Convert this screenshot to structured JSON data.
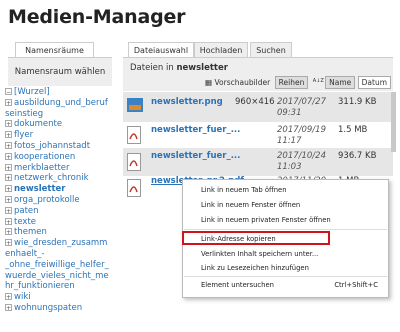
{
  "page": {
    "title": "Medien-Manager"
  },
  "left": {
    "tab_label": "Namensräume",
    "header": "Namensraum wählen",
    "tree": [
      {
        "label": "[Wurzel]",
        "pm": "⊟"
      },
      {
        "label": "ausbildung_und_beruf",
        "pm": "⊞"
      },
      {
        "label": "seinstieg",
        "pm": ""
      },
      {
        "label": "dokumente",
        "pm": "⊞"
      },
      {
        "label": "flyer",
        "pm": "⊞"
      },
      {
        "label": "fotos_johannstadt",
        "pm": "⊞"
      },
      {
        "label": "kooperationen",
        "pm": "⊞"
      },
      {
        "label": "merkblaetter",
        "pm": "⊞"
      },
      {
        "label": "netzwerk_chronik",
        "pm": "⊞"
      },
      {
        "label": "newsletter",
        "pm": "⊞"
      },
      {
        "label": "orga_protokolle",
        "pm": "⊞"
      },
      {
        "label": "paten",
        "pm": "⊞"
      },
      {
        "label": "texte",
        "pm": "⊞"
      },
      {
        "label": "themen",
        "pm": "⊞"
      },
      {
        "label": "wie_dresden_zusamm",
        "pm": "⊞"
      },
      {
        "label": "enhaelt_-",
        "pm": ""
      },
      {
        "label": "_ohne_freiwillige_helfer_",
        "pm": ""
      },
      {
        "label": "wuerde_vieles_nicht_me",
        "pm": ""
      },
      {
        "label": "hr_funktionieren",
        "pm": ""
      },
      {
        "label": "wiki",
        "pm": "⊞"
      },
      {
        "label": "wohnungspaten",
        "pm": "⊞"
      }
    ]
  },
  "right": {
    "tabs": [
      "Dateiauswahl",
      "Hochladen",
      "Suchen"
    ],
    "files_in_label": "Dateien in",
    "namespace": "newsletter",
    "view_label": "Vorschaubilder",
    "view_rows_label": "Reihen",
    "sort_name_label": "Name",
    "sort_date_label": "Datum",
    "sort_icon_text": "A↓Z",
    "files": [
      {
        "name": "newsletter.png",
        "dim": "960×416",
        "date1": "2017/07/27",
        "date2": "09:31",
        "size": "311.9 KB",
        "icon": "image-icon"
      },
      {
        "name": "newsletter_fuer_...",
        "dim": "",
        "date1": "2017/09/19",
        "date2": "11:17",
        "size": "1.5 MB",
        "icon": "pdf-icon"
      },
      {
        "name": "newsletter_fuer_...",
        "dim": "",
        "date1": "2017/10/24",
        "date2": "11:03",
        "size": "936.7 KB",
        "icon": "pdf-icon"
      },
      {
        "name": "newsletter_nr.2.pdf",
        "dim": "",
        "date1": "2017/11/20",
        "date2": "",
        "size": "1 MB",
        "icon": "pdf-icon"
      }
    ]
  },
  "menu": {
    "items": [
      "Link in neuem Tab öffnen",
      "Link in neuem Fenster öffnen",
      "Link in neuem privaten Fenster öffnen",
      "Link-Adresse kopieren",
      "Verlinkten Inhalt speichern unter...",
      "Link zu Lesezeichen hinzufügen",
      "Element untersuchen"
    ],
    "shortcut": "Ctrl+Shift+C",
    "highlight_color": "#d0141b"
  },
  "colors": {
    "link": "#2b73b7",
    "panel": "#eeeeee"
  }
}
